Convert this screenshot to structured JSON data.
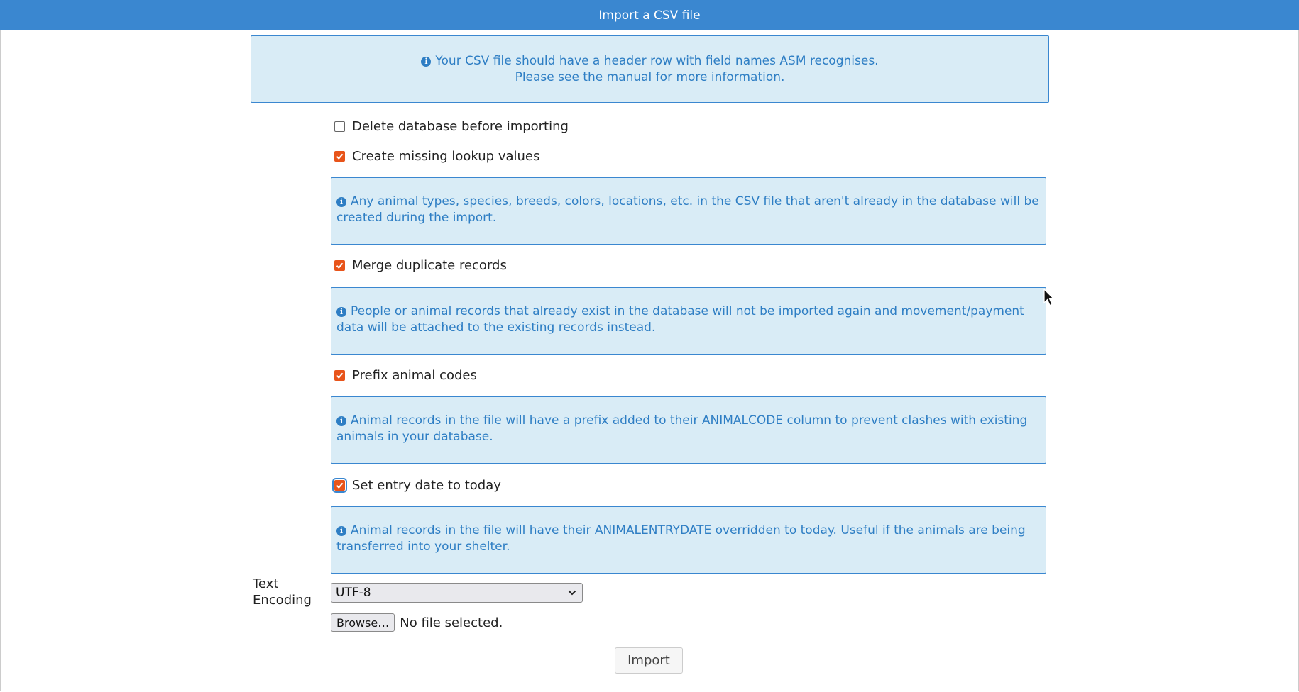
{
  "dialog": {
    "title": "Import a CSV file"
  },
  "intro": {
    "line1": "Your CSV file should have a header row with field names ASM recognises.",
    "line2": "Please see the manual for more information."
  },
  "options": [
    {
      "label": "Delete database before importing",
      "checked": false
    },
    {
      "label": "Create missing lookup values",
      "checked": true,
      "help": "Any animal types, species, breeds, colors, locations, etc. in the CSV file that aren't already in the database will be created during the import."
    },
    {
      "label": "Merge duplicate records",
      "checked": true,
      "help": "People or animal records that already exist in the database will not be imported again and movement/payment data will be attached to the existing records instead."
    },
    {
      "label": "Prefix animal codes",
      "checked": true,
      "help": "Animal records in the file will have a prefix added to their ANIMALCODE column to prevent clashes with existing animals in your database."
    },
    {
      "label": "Set entry date to today",
      "checked": true,
      "help": "Animal records in the file will have their ANIMALENTRYDATE overridden to today. Useful if the animals are being transferred into your shelter."
    }
  ],
  "encoding": {
    "label_line1": "Text",
    "label_line2": "Encoding",
    "value": "UTF-8"
  },
  "file": {
    "browse_label": "Browse…",
    "status": "No file selected."
  },
  "import_label": "Import",
  "colors": {
    "header": "#3a87d0",
    "info_bg": "#d9ecf6",
    "info_text": "#2e7ec4",
    "checkbox_on": "#e8541a"
  },
  "icons": {
    "info": "info-circle-icon",
    "check": "checkmark-icon",
    "select": "chevron-down-icon",
    "pointer": "mouse-cursor-icon"
  }
}
